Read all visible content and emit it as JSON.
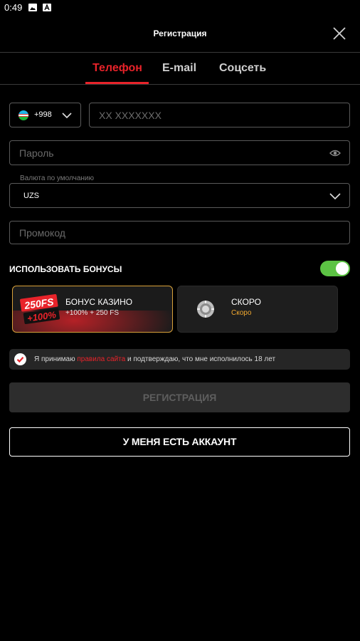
{
  "statusbar": {
    "time": "0:49",
    "icons": [
      "image-icon",
      "a-icon"
    ]
  },
  "header": {
    "title": "Регистрация",
    "close_icon": "close-icon"
  },
  "tabs": [
    {
      "label": "Телефон",
      "active": true
    },
    {
      "label": "E-mail",
      "active": false
    },
    {
      "label": "Соцсеть",
      "active": false
    }
  ],
  "form": {
    "country_code": "+998",
    "phone_placeholder": "XX XXXXXXX",
    "password_placeholder": "Пароль",
    "currency_label": "Валюта по умолчанию",
    "currency_value": "UZS",
    "promo_placeholder": "Промокод"
  },
  "bonuses": {
    "label": "ИСПОЛЬЗОВАТЬ БОНУСЫ",
    "enabled": true,
    "cards": [
      {
        "badge_line1": "250FS",
        "badge_line2": "+100%",
        "title": "БОНУС КАЗИНО",
        "subtitle": "+100% + 250 FS",
        "selected": true
      },
      {
        "title": "СКОРО",
        "subtitle": "Скоро",
        "selected": false
      }
    ]
  },
  "agreement": {
    "prefix": "Я принимаю ",
    "link": "правила сайта",
    "suffix": " и подтверждаю, что мне исполнилось 18 лет",
    "checked": true
  },
  "buttons": {
    "register": "РЕГИСТРАЦИЯ",
    "login": "У МЕНЯ ЕСТЬ АККАУНТ"
  },
  "colors": {
    "accent": "#e8232a",
    "toggle_on": "#5cc344",
    "card_selected_border": "#d9a23a",
    "soon_text": "#f0a830",
    "background": "#000000"
  }
}
